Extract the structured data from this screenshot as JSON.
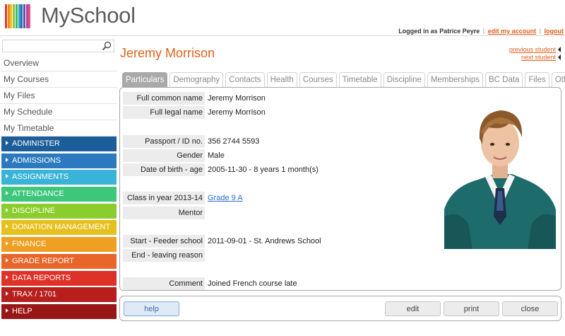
{
  "app": {
    "title": "MySchool"
  },
  "logo_colors": [
    "#e8362a",
    "#f28a1e",
    "#f5c11f",
    "#8cc63f",
    "#38b46b",
    "#2aa6c9",
    "#2d6fb7",
    "#6a4ea0",
    "#b0489a",
    "#e5508a"
  ],
  "userbar": {
    "prefix": "Logged in as Patrice Peyre",
    "edit_account": "edit my account",
    "separator": "|",
    "logout": "logout"
  },
  "search": {
    "placeholder": ""
  },
  "sidebar": {
    "links": [
      "Overview",
      "My Courses",
      "My Files",
      "My Schedule",
      "My Timetable"
    ],
    "modules": [
      {
        "label": "ADMINISTER",
        "color": "#1c5e9a"
      },
      {
        "label": "ADMISSIONS",
        "color": "#2b79be"
      },
      {
        "label": "ASSIGNMENTS",
        "color": "#3ab3d8"
      },
      {
        "label": "ATTENDANCE",
        "color": "#3ec77c"
      },
      {
        "label": "DISCIPLINE",
        "color": "#8bcd2c"
      },
      {
        "label": "DONATION MANAGEMENT",
        "color": "#e6c11e"
      },
      {
        "label": "FINANCE",
        "color": "#ef9f22"
      },
      {
        "label": "GRADE REPORT",
        "color": "#e8662a"
      },
      {
        "label": "DATA REPORTS",
        "color": "#de3228"
      },
      {
        "label": "TRAX / 1701",
        "color": "#b61f1c"
      },
      {
        "label": "HELP",
        "color": "#991616"
      }
    ]
  },
  "student": {
    "name": "Jeremy Morrison",
    "previous_label": "previous student",
    "next_label": "next student"
  },
  "tabs": [
    "Particulars",
    "Demography",
    "Contacts",
    "Health",
    "Courses",
    "Timetable",
    "Discipline",
    "Memberships",
    "BC Data",
    "Files",
    "Others"
  ],
  "active_tab": 0,
  "particulars": [
    {
      "label": "Full common name",
      "value": "Jeremy Morrison"
    },
    {
      "label": "Full legal name",
      "value": "Jeremy Morrison"
    },
    {
      "label": "",
      "value": ""
    },
    {
      "label": "Passport / ID no.",
      "value": "356 2744 5593"
    },
    {
      "label": "Gender",
      "value": "Male"
    },
    {
      "label": "Date of birth - age",
      "value": "2005-11-30 - 8 years 1 month(s)"
    },
    {
      "label": "",
      "value": ""
    },
    {
      "label": "Class in year 2013-14",
      "value": "Grade 9 A",
      "link": true
    },
    {
      "label": "Mentor",
      "value": ""
    },
    {
      "label": "",
      "value": ""
    },
    {
      "label": "Start - Feeder school",
      "value": "2011-09-01 - St. Andrews School"
    },
    {
      "label": "End - leaving reason",
      "value": ""
    },
    {
      "label": "",
      "value": ""
    },
    {
      "label": "Comment",
      "value": "Joined French course late"
    }
  ],
  "buttons": {
    "help": "help",
    "edit": "edit",
    "print": "print",
    "close": "close"
  }
}
